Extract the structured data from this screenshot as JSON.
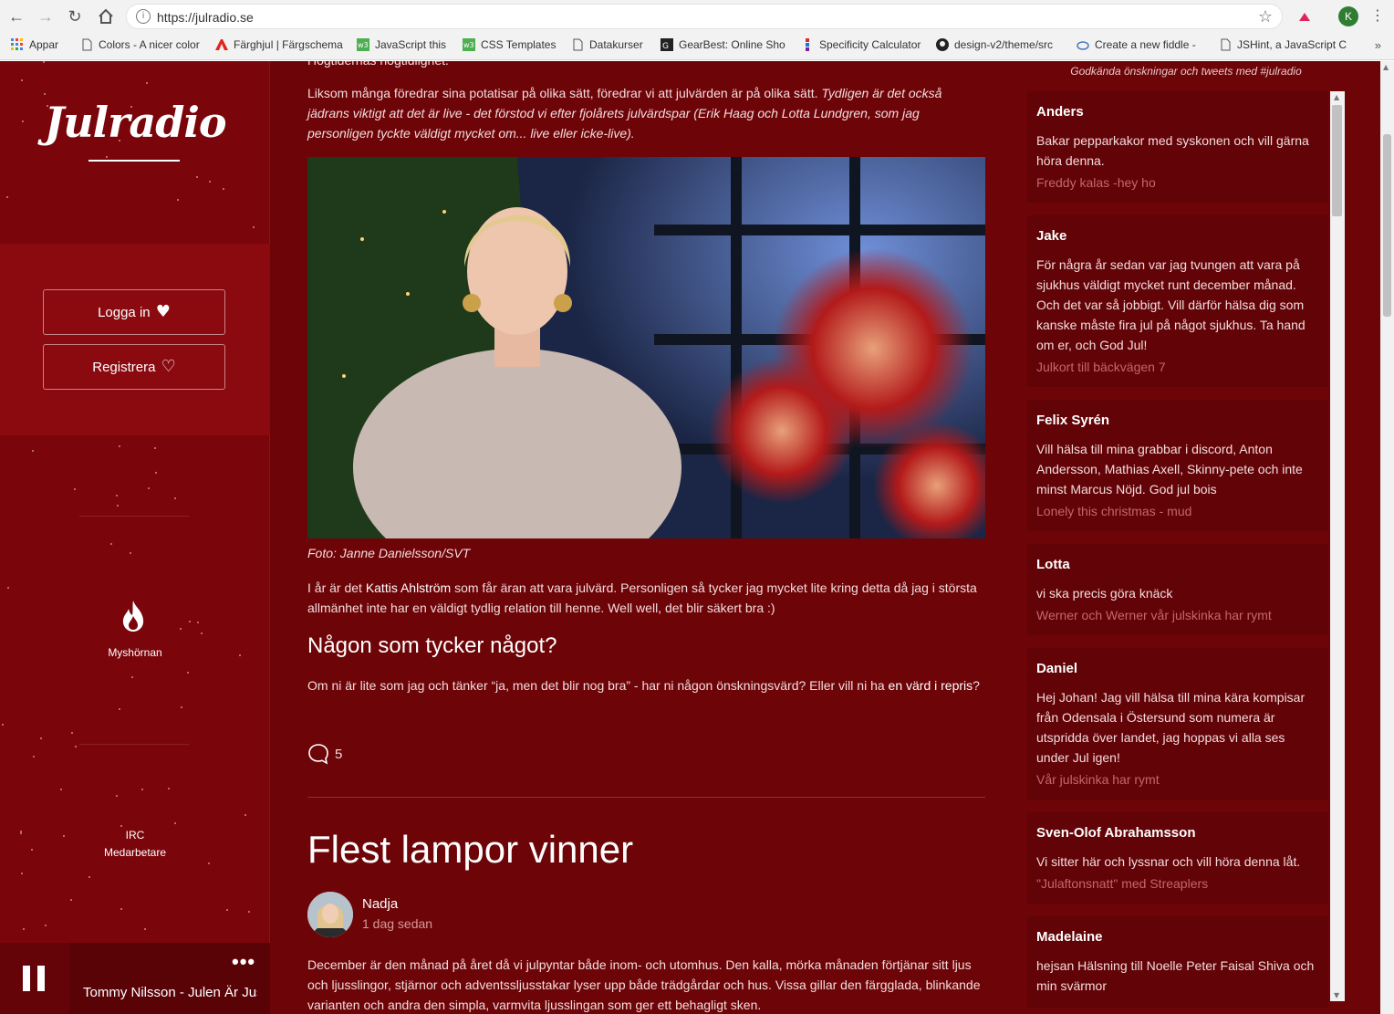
{
  "browser": {
    "url": "https://julradio.se",
    "profile_initial": "K",
    "bookmarks": [
      {
        "label": "Appar",
        "icon": "apps-grid-icon"
      },
      {
        "label": "Colors - A nicer color",
        "icon": "page-icon"
      },
      {
        "label": "Färghjul | Färgschema",
        "icon": "adobe-icon"
      },
      {
        "label": "JavaScript this",
        "icon": "w3-icon"
      },
      {
        "label": "CSS Templates",
        "icon": "w3-icon"
      },
      {
        "label": "Datakurser",
        "icon": "page-icon"
      },
      {
        "label": "GearBest: Online Sho",
        "icon": "gearbest-icon"
      },
      {
        "label": "Specificity Calculator",
        "icon": "specificity-icon"
      },
      {
        "label": "design-v2/theme/src",
        "icon": "github-icon"
      },
      {
        "label": "Create a new fiddle -",
        "icon": "jsfiddle-icon"
      },
      {
        "label": "JSHint, a JavaScript C",
        "icon": "page-icon"
      }
    ],
    "bookmarks_more": "»"
  },
  "sidebar": {
    "logo": "Julradio",
    "login_label": "Logga in",
    "register_label": "Registrera",
    "myshornan_label": "Myshörnan",
    "irc_label": "IRC",
    "staff_label": "Medarbetare"
  },
  "player": {
    "now_playing": "Tommy Nilsson - Julen Är Just Här",
    "more_label": "•••"
  },
  "article": {
    "top_cut_text": "Högtidernas högtidlighet.",
    "intro_plain": "Liksom många föredrar sina potatisar på olika sätt, föredrar vi att julvärden är på olika sätt. ",
    "intro_italic": "Tydligen är det också jädrans viktigt att det är live - det förstod vi efter fjolårets julvärdspar (Erik Haag och Lotta Lundgren, som jag personligen tyckte väldigt mycket om... live eller icke-live).",
    "photo_caption": "Foto: Janne Danielsson/SVT",
    "host_p1": "I år är det ",
    "host_name": "Kattis Ahlström",
    "host_p2": " som får äran att vara julvärd. Personligen så tycker jag mycket lite kring detta då jag i största allmänhet inte har en väldigt tydlig relation till henne. Well well, det blir säkert bra :)",
    "subheading": "Någon som tycker något?",
    "question_p1": "Om ni är lite som jag och tänker “ja, men det blir nog bra” - har ni någon önskningsvärd? Eller vill ni ha ",
    "question_link": "en värd i repris",
    "question_p2": "?",
    "comment_count": "5"
  },
  "next_post": {
    "title": "Flest lampor vinner",
    "author": "Nadja",
    "posted": "1 dag sedan",
    "excerpt": "December är den månad på året då vi julpyntar både inom- och utomhus. Den kalla, mörka månaden förtjänar sitt ljus och ljusslingor, stjärnor och adventssljusstakar lyser upp både trädgårdar och hus. Vissa gillar den färgglada, blinkande varianten och andra den simpla, varmvita ljusslingan som ger ett behagligt sken."
  },
  "wishes": {
    "note": "Godkända önskningar och tweets med #julradio",
    "items": [
      {
        "name": "Anders",
        "message": "Bakar pepparkakor med syskonen och vill gärna höra denna.",
        "song": "Freddy kalas -hey ho"
      },
      {
        "name": "Jake",
        "message": "För några år sedan var jag tvungen att vara på sjukhus väldigt mycket runt december månad. Och det var så jobbigt. Vill därför hälsa dig som kanske måste fira jul på något sjukhus. Ta hand om er, och God Jul!",
        "song": "Julkort till bäckvägen 7"
      },
      {
        "name": "Felix Syrén",
        "message": "Vill hälsa till mina grabbar i discord, Anton Andersson, Mathias Axell, Skinny-pete och inte minst Marcus Nöjd. God jul bois",
        "song": "Lonely this christmas - mud"
      },
      {
        "name": "Lotta",
        "message": "vi ska precis göra knäck",
        "song": "Werner och Werner vår julskinka har rymt"
      },
      {
        "name": "Daniel",
        "message": "Hej Johan! Jag vill hälsa till mina kära kompisar från Odensala i Östersund som numera är utspridda över landet, jag hoppas vi alla ses under Jul igen!",
        "song": "Vår julskinka har rymt"
      },
      {
        "name": "Sven-Olof Abrahamsson",
        "message": "Vi sitter här och lyssnar och vill höra denna låt.",
        "song": "\"Julaftonsnatt\" med Streaplers"
      },
      {
        "name": "Madelaine",
        "message": "hejsan Hälsning till Noelle Peter Faisal Shiva och min svärmor",
        "song": ""
      }
    ]
  },
  "colors": {
    "page_bg": "#6d0408",
    "sidebar_bg": "#7a050b",
    "card_bg": "#620307",
    "song_text": "#c46868"
  }
}
